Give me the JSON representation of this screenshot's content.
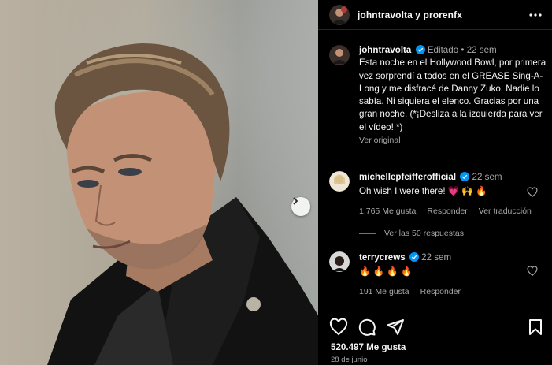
{
  "post": {
    "header_title": "johntravolta y prorenfx",
    "author": "johntravolta",
    "edited_label": "Editado",
    "age": "22 sem",
    "caption": "Esta noche en el Hollywood Bowl, por primera vez sorprendí a todos en el GREASE Sing-A-Long y me disfracé de Danny Zuko. Nadie lo sabía. Ni siquiera el elenco. Gracias por una gran noche. (*¡Desliza a la izquierda para ver el vídeo! *)",
    "see_original": "Ver original",
    "likes": "520.497 Me gusta",
    "date": "28 de junio"
  },
  "comments": [
    {
      "user": "michellepfeifferofficial",
      "age": "22 sem",
      "text": "Oh wish I were there! ",
      "emoji": "💗 🙌 🔥",
      "likes": "1.765 Me gusta",
      "reply_label": "Responder",
      "translate_label": "Ver traducción",
      "view_replies": "Ver las 50 respuestas"
    },
    {
      "user": "terrycrews",
      "age": "22 sem",
      "emoji": "🔥 🔥 🔥 🔥",
      "likes": "191 Me gusta",
      "reply_label": "Responder"
    }
  ],
  "colors": {
    "background": "#000000",
    "text": "#f5f5f5",
    "secondary_text": "#a8a8a8",
    "verified_blue": "#0095f6",
    "divider": "#262626"
  },
  "icons": [
    "more-icon",
    "verified-icon",
    "heart-icon",
    "comment-icon",
    "share-icon",
    "bookmark-icon",
    "chevron-right-icon"
  ]
}
